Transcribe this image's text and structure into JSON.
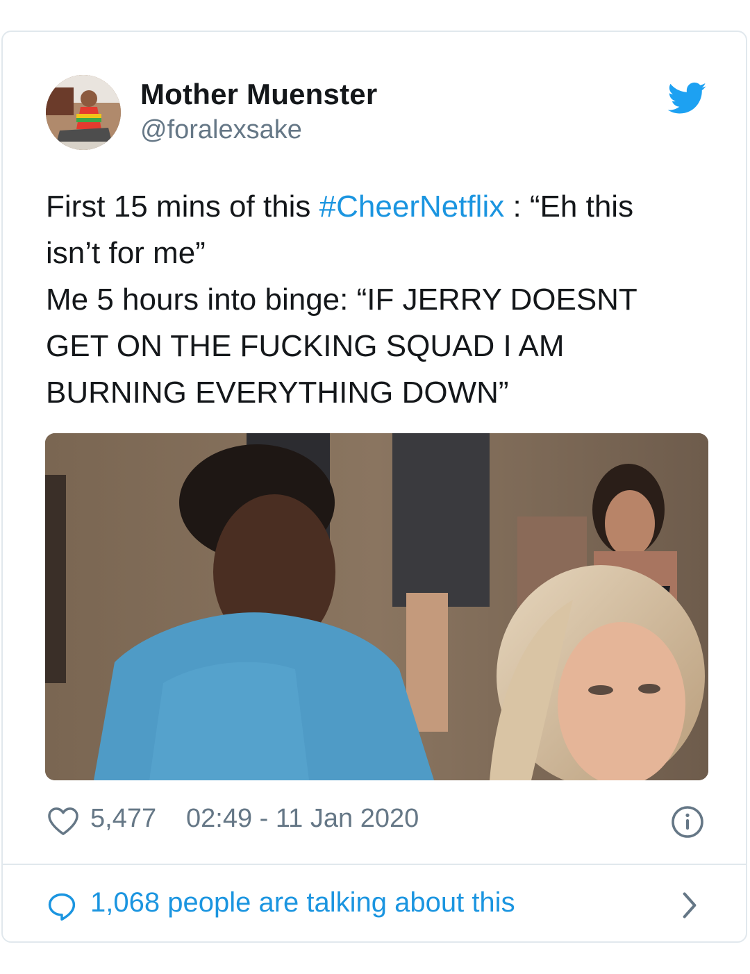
{
  "author": {
    "display_name": "Mother Muenster",
    "handle": "@foralexsake"
  },
  "tweet": {
    "lines": [
      {
        "before": "First 15 mins of this ",
        "hashtag": "#CheerNetflix",
        "after": " : “Eh this"
      },
      {
        "text": "isn’t for me”"
      },
      {
        "text": "Me 5 hours into binge: “IF JERRY DOESNT"
      },
      {
        "text": "GET ON THE FUCKING SQUAD I AM"
      },
      {
        "text": "BURNING EVERYTHING DOWN”"
      }
    ]
  },
  "footer": {
    "likes": "5,477",
    "timestamp": "02:49 - 11 Jan 2020"
  },
  "conversation": {
    "label": "1,068 people are talking about this"
  },
  "icons": {
    "brand": "twitter-bird-icon",
    "like": "heart-icon",
    "info": "info-icon",
    "reply": "speech-bubble-icon",
    "more": "chevron-right-icon"
  },
  "colors": {
    "brand": "#1da1f2",
    "link": "#1b95e0",
    "secondary_text": "#657786",
    "border": "#e1e8ed"
  }
}
